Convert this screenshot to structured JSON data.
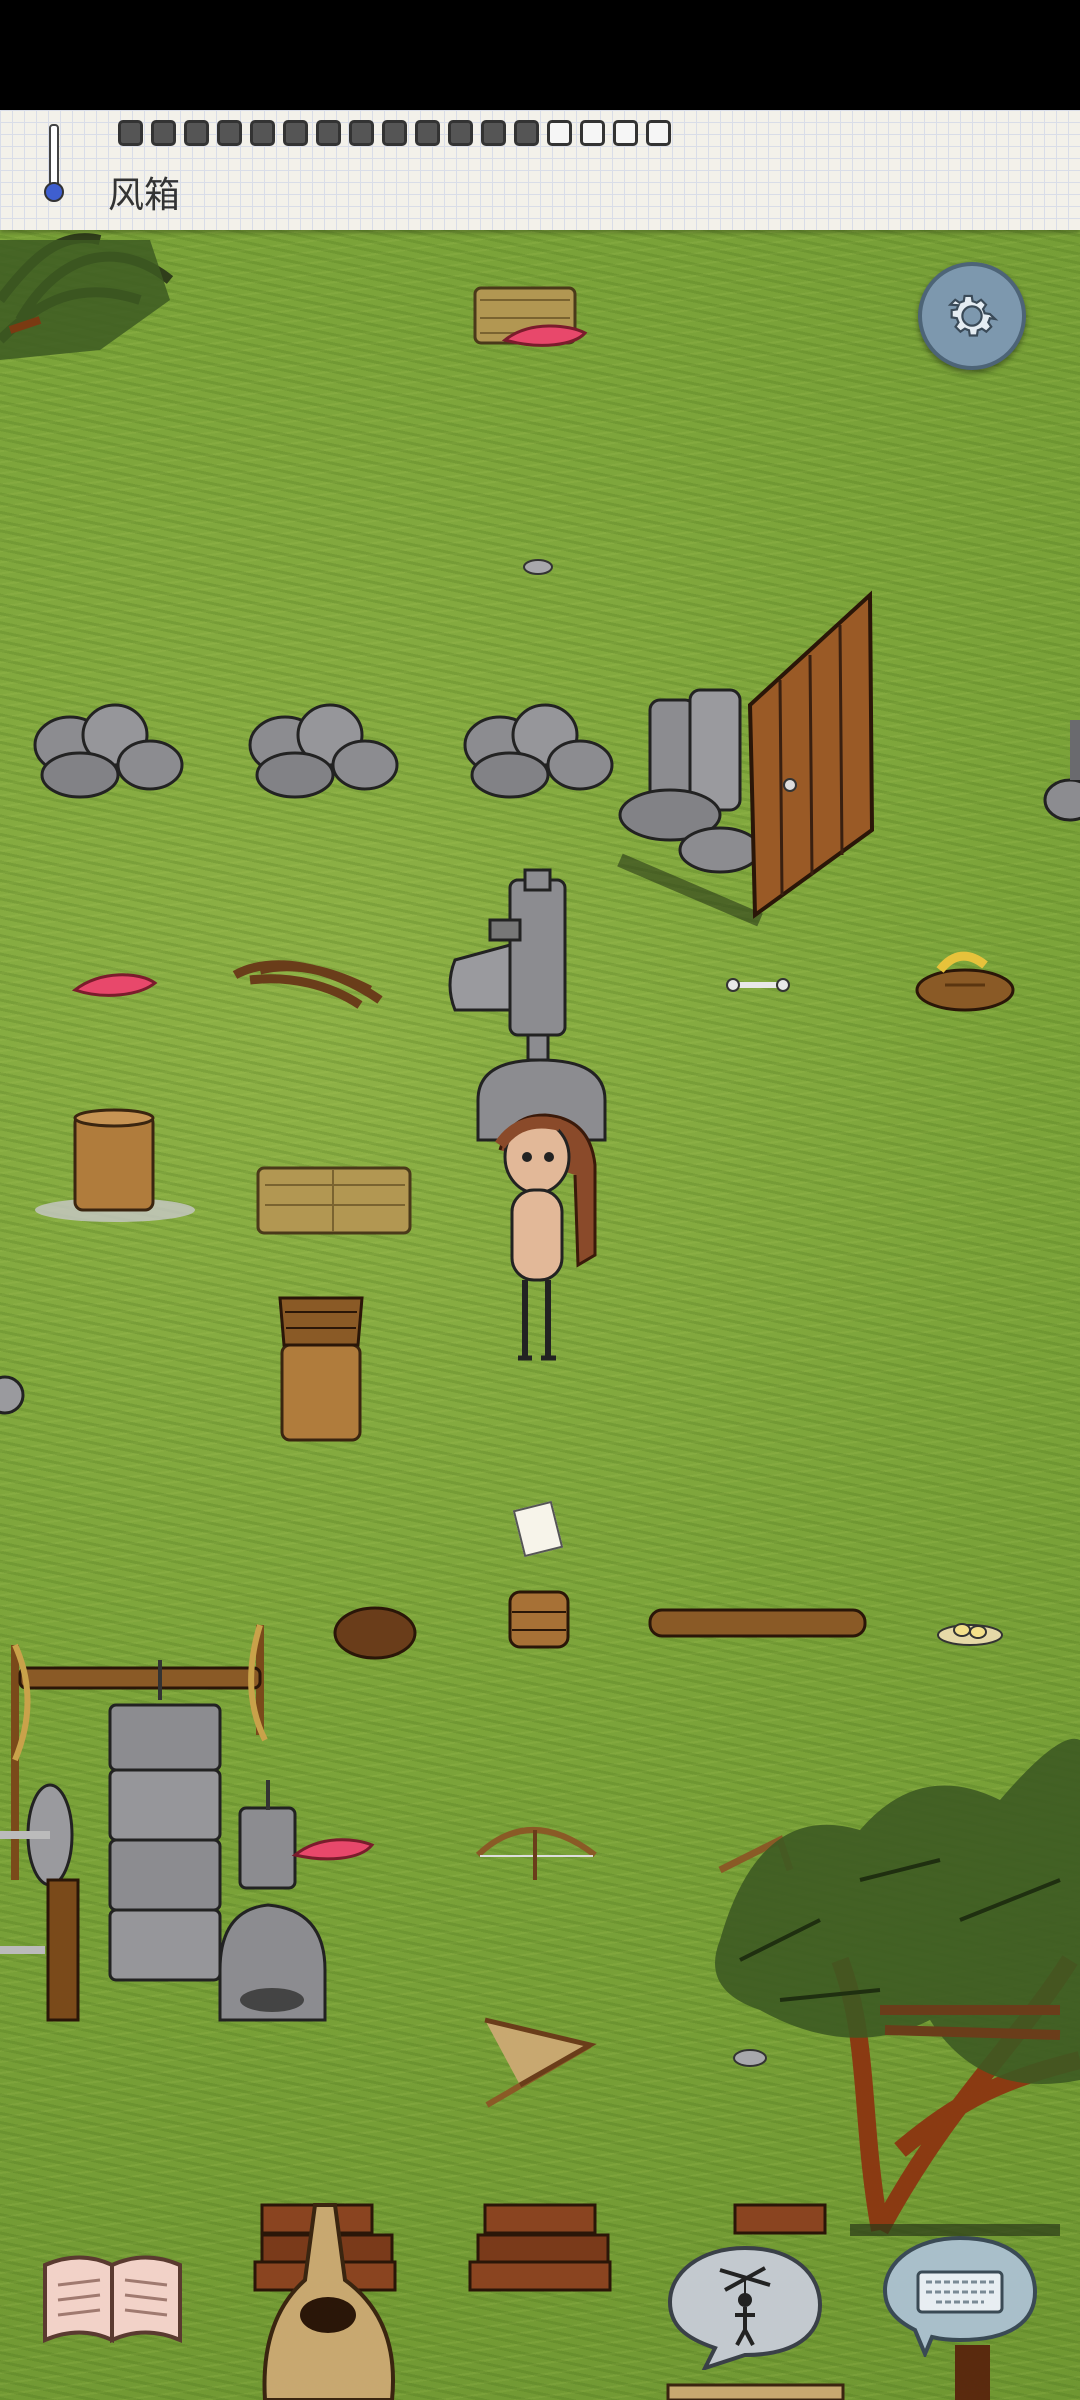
{
  "hud": {
    "held_item_label": "风箱",
    "food_pips_filled": 13,
    "food_pips_total": 17,
    "thermometer_icon": "thermometer-icon"
  },
  "controls": {
    "settings_icon": "gear-icon",
    "book_icon": "open-book-icon",
    "emote_icon": "puppet-speech-icon",
    "keyboard_icon": "keyboard-speech-icon"
  },
  "colors": {
    "grass": "#7ca43a",
    "stone": "#8c8c90",
    "wood": "#8a5a26",
    "settings_button": "#7d98ae"
  }
}
